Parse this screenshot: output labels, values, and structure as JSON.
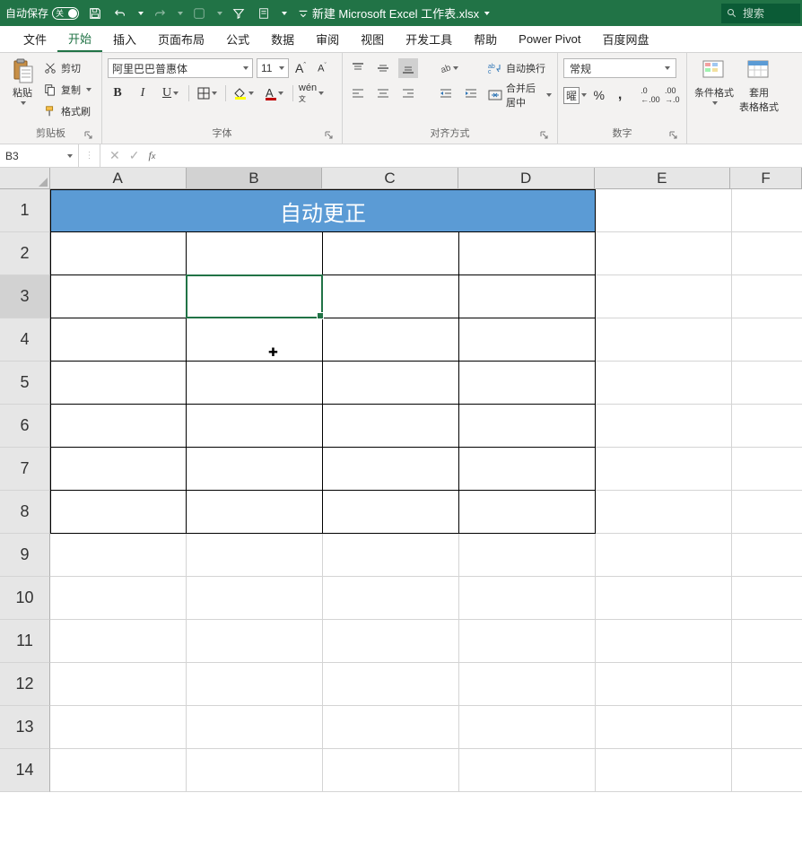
{
  "titlebar": {
    "autosave_label": "自动保存",
    "autosave_state": "关",
    "filename": "新建 Microsoft Excel 工作表.xlsx",
    "search_placeholder": "搜索"
  },
  "tabs": {
    "items": [
      {
        "label": "文件"
      },
      {
        "label": "开始",
        "active": true
      },
      {
        "label": "插入"
      },
      {
        "label": "页面布局"
      },
      {
        "label": "公式"
      },
      {
        "label": "数据"
      },
      {
        "label": "审阅"
      },
      {
        "label": "视图"
      },
      {
        "label": "开发工具"
      },
      {
        "label": "帮助"
      },
      {
        "label": "Power Pivot"
      },
      {
        "label": "百度网盘"
      }
    ]
  },
  "ribbon": {
    "clipboard": {
      "label": "剪贴板",
      "paste": "粘贴",
      "cut": "剪切",
      "copy": "复制",
      "formatpainter": "格式刷"
    },
    "font": {
      "label": "字体",
      "name": "阿里巴巴普惠体",
      "size": "11"
    },
    "alignment": {
      "label": "对齐方式",
      "wrap": "自动换行",
      "merge": "合并后居中"
    },
    "number": {
      "label": "数字",
      "format": "常规"
    },
    "styles": {
      "cond": "条件格式",
      "table": "套用\n表格格式"
    }
  },
  "formula_bar": {
    "cell_ref": "B3",
    "formula": ""
  },
  "sheet": {
    "columns": [
      "A",
      "B",
      "C",
      "D",
      "E",
      "F"
    ],
    "active_column_index": 1,
    "rows": [
      "1",
      "2",
      "3",
      "4",
      "5",
      "6",
      "7",
      "8",
      "9",
      "10",
      "11",
      "12",
      "13",
      "14"
    ],
    "active_row_index": 2,
    "merged_title": "自动更正",
    "bordered_rows_start": 1,
    "bordered_rows_end": 8,
    "bordered_cols": 4,
    "selection": {
      "col": 1,
      "row": 2
    }
  },
  "colors": {
    "brand": "#217346",
    "merged_fill": "#5b9bd5"
  }
}
